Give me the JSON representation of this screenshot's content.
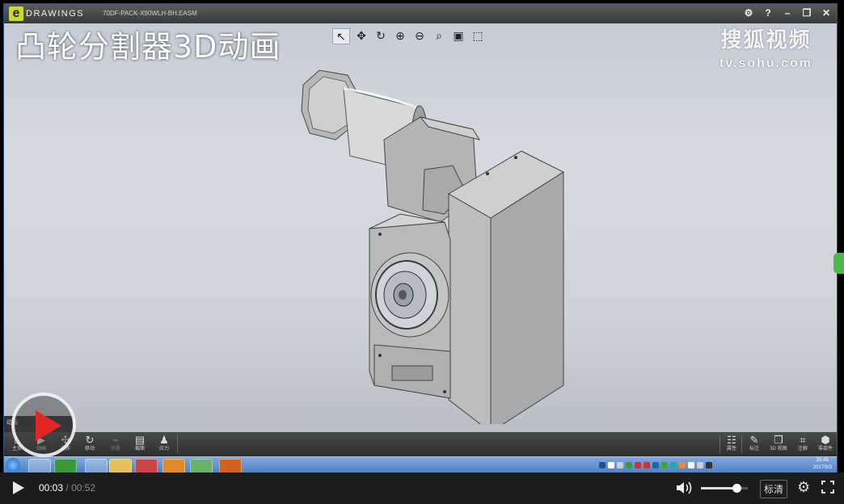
{
  "app": {
    "logo_e": "e",
    "logo_text": "DRAWINGS",
    "file_name": "70DF-PACK-X90WLH-BH.EASM",
    "window_controls": [
      "⚙",
      "?",
      "–",
      "❐",
      "✕"
    ]
  },
  "viewport": {
    "overlay_title": "凸轮分割器3D动画",
    "toolbar_icons": [
      "select-arrow-icon",
      "pan-icon",
      "rotate-icon",
      "zoom-area-icon",
      "zoom-icon",
      "zoom-fit-icon",
      "display-style-icon",
      "view-orientation-icon"
    ],
    "watermark": {
      "cn": "搜狐视频",
      "url": "tv.sohu.com"
    }
  },
  "animation_panel": {
    "label": "动画"
  },
  "command_bar": {
    "left": [
      {
        "label": "主页",
        "icon": "home-icon"
      },
      {
        "label": "动画",
        "icon": "animation-icon"
      },
      {
        "label": "爆炸",
        "icon": "explode-icon"
      },
      {
        "label": "移动",
        "icon": "move-icon"
      },
      {
        "label": "测量",
        "icon": "measure-icon"
      },
      {
        "label": "截面",
        "icon": "section-icon"
      },
      {
        "label": "应力",
        "icon": "stress-icon"
      }
    ],
    "right": [
      {
        "label": "属性",
        "icon": "properties-icon"
      },
      {
        "label": "标注",
        "icon": "markup-icon"
      },
      {
        "label": "3D 视图",
        "icon": "3d-view-icon"
      },
      {
        "label": "注解",
        "icon": "annotation-icon"
      },
      {
        "label": "零部件",
        "icon": "components-icon"
      }
    ]
  },
  "taskbar": {
    "clock_time": "20:45",
    "clock_date": "2017/5/3"
  },
  "video_bar": {
    "current_time": "00:03",
    "separator": "/",
    "total_time": "00:52",
    "quality_label": "标清",
    "volume_level": 0.75
  },
  "colors": {
    "accent_red": "#e52525",
    "viewport_bg": "#cfd3d9",
    "model_gray": "#a8a8a8"
  }
}
